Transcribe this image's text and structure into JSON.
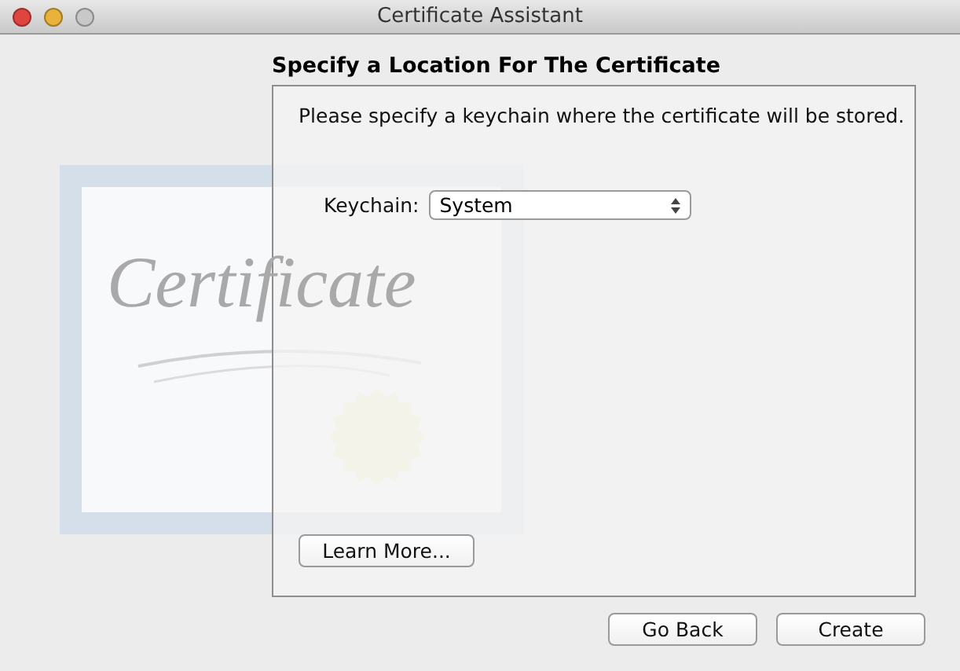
{
  "window": {
    "title": "Certificate Assistant",
    "buttons": [
      {
        "kind": "close"
      },
      {
        "kind": "minimize"
      },
      {
        "kind": "zoom",
        "disabled": true
      }
    ]
  },
  "certificate_art": {
    "script": "Certificate"
  },
  "heading": "Specify a Location For The Certificate",
  "panel": {
    "instruction": "Please specify a keychain where the certificate will be stored.",
    "keychain": {
      "label": "Keychain:",
      "value": "System"
    },
    "learn_more": "Learn More..."
  },
  "buttons": [
    {
      "label": "Go Back"
    },
    {
      "label": "Create"
    }
  ]
}
